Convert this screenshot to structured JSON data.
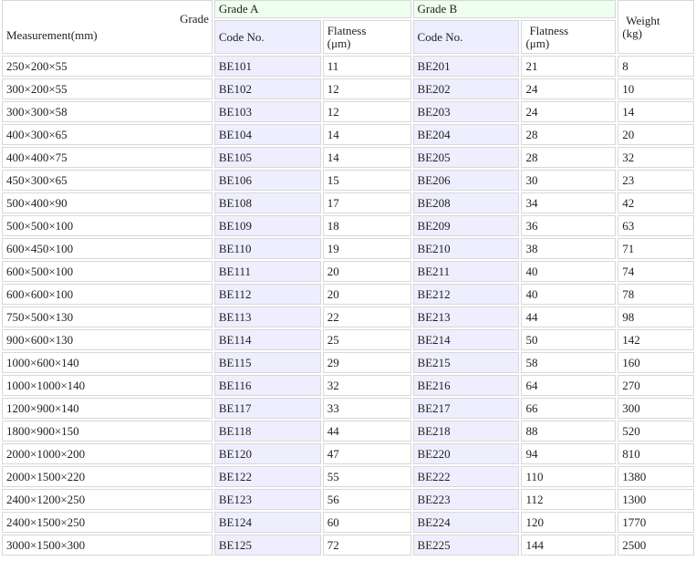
{
  "header": {
    "corner_top": "Grade",
    "corner_bottom": "Measurement(mm)",
    "grade_a": "Grade A",
    "grade_b": "Grade B",
    "weight_line1": "Weight",
    "weight_line2": "(kg)",
    "code_no": "Code No.",
    "flatness_line1": "Flatness",
    "flatness_line2": "(μm)"
  },
  "rows": [
    {
      "m": "250×200×55",
      "ca": "BE101",
      "fa": "11",
      "cb": "BE201",
      "fb": "21",
      "w": "8"
    },
    {
      "m": "300×200×55",
      "ca": "BE102",
      "fa": "12",
      "cb": "BE202",
      "fb": "24",
      "w": "10"
    },
    {
      "m": "300×300×58",
      "ca": "BE103",
      "fa": "12",
      "cb": "BE203",
      "fb": "24",
      "w": "14"
    },
    {
      "m": "400×300×65",
      "ca": "BE104",
      "fa": "14",
      "cb": "BE204",
      "fb": "28",
      "w": "20"
    },
    {
      "m": "400×400×75",
      "ca": "BE105",
      "fa": "14",
      "cb": "BE205",
      "fb": "28",
      "w": "32"
    },
    {
      "m": "450×300×65",
      "ca": "BE106",
      "fa": "15",
      "cb": "BE206",
      "fb": "30",
      "w": "23"
    },
    {
      "m": "500×400×90",
      "ca": "BE108",
      "fa": "17",
      "cb": "BE208",
      "fb": "34",
      "w": "42"
    },
    {
      "m": "500×500×100",
      "ca": "BE109",
      "fa": "18",
      "cb": "BE209",
      "fb": "36",
      "w": "63"
    },
    {
      "m": "600×450×100",
      "ca": "BE110",
      "fa": "19",
      "cb": "BE210",
      "fb": "38",
      "w": "71"
    },
    {
      "m": "600×500×100",
      "ca": "BE111",
      "fa": "20",
      "cb": "BE211",
      "fb": "40",
      "w": "74"
    },
    {
      "m": "600×600×100",
      "ca": "BE112",
      "fa": "20",
      "cb": "BE212",
      "fb": "40",
      "w": "78"
    },
    {
      "m": "750×500×130",
      "ca": "BE113",
      "fa": "22",
      "cb": "BE213",
      "fb": "44",
      "w": "98"
    },
    {
      "m": "900×600×130",
      "ca": "BE114",
      "fa": "25",
      "cb": "BE214",
      "fb": "50",
      "w": "142"
    },
    {
      "m": "1000×600×140",
      "ca": "BE115",
      "fa": "29",
      "cb": "BE215",
      "fb": "58",
      "w": "160"
    },
    {
      "m": "1000×1000×140",
      "ca": "BE116",
      "fa": "32",
      "cb": "BE216",
      "fb": "64",
      "w": "270"
    },
    {
      "m": "1200×900×140",
      "ca": "BE117",
      "fa": "33",
      "cb": "BE217",
      "fb": "66",
      "w": "300"
    },
    {
      "m": "1800×900×150",
      "ca": "BE118",
      "fa": "44",
      "cb": "BE218",
      "fb": "88",
      "w": "520"
    },
    {
      "m": "2000×1000×200",
      "ca": "BE120",
      "fa": "47",
      "cb": "BE220",
      "fb": "94",
      "w": "810"
    },
    {
      "m": "2000×1500×220",
      "ca": "BE122",
      "fa": "55",
      "cb": "BE222",
      "fb": "110",
      "w": "1380"
    },
    {
      "m": "2400×1200×250",
      "ca": "BE123",
      "fa": "56",
      "cb": "BE223",
      "fb": "112",
      "w": "1300"
    },
    {
      "m": "2400×1500×250",
      "ca": "BE124",
      "fa": "60",
      "cb": "BE224",
      "fb": "120",
      "w": "1770"
    },
    {
      "m": "3000×1500×300",
      "ca": "BE125",
      "fa": "72",
      "cb": "BE225",
      "fb": "144",
      "w": "2500"
    }
  ]
}
